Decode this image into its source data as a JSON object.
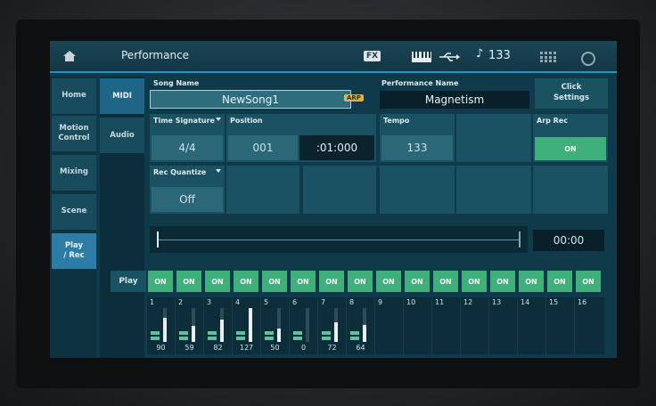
{
  "titlebar": {
    "title": "Performance",
    "fx_label": "FX",
    "tempo": "133",
    "icons": [
      "home-icon",
      "keyboard-icon",
      "usb-icon",
      "note-icon",
      "grid-icon",
      "gear-icon"
    ]
  },
  "nav": {
    "items": [
      "Home",
      "Motion\nControl",
      "Mixing",
      "Scene",
      "Play\n/ Rec"
    ],
    "active": "Play\n/ Rec"
  },
  "subnav": {
    "items": [
      "MIDI",
      "Audio"
    ],
    "active": "MIDI"
  },
  "song": {
    "label": "Song Name",
    "value": "NewSong1",
    "arp_badge": "ARP"
  },
  "performance": {
    "label": "Performance Name",
    "value": "Magnetism"
  },
  "click": {
    "label": "Click\nSettings"
  },
  "time_signature": {
    "label": "Time Signature",
    "value": "4/4"
  },
  "position": {
    "label": "Position",
    "measure": "001",
    "beat": ":01:000"
  },
  "tempo": {
    "label": "Tempo",
    "value": "133"
  },
  "arp_rec": {
    "label": "Arp Rec",
    "value": "ON"
  },
  "rec_quantize": {
    "label": "Rec Quantize",
    "value": "Off"
  },
  "time_display": "00:00",
  "play": {
    "label": "Play",
    "buttons": [
      "ON",
      "ON",
      "ON",
      "ON",
      "ON",
      "ON",
      "ON",
      "ON",
      "ON",
      "ON",
      "ON",
      "ON",
      "ON",
      "ON",
      "ON",
      "ON"
    ]
  },
  "tracks": [
    {
      "num": "1",
      "value": "90"
    },
    {
      "num": "2",
      "value": "59"
    },
    {
      "num": "3",
      "value": "82"
    },
    {
      "num": "4",
      "value": "127"
    },
    {
      "num": "5",
      "value": "50"
    },
    {
      "num": "6",
      "value": "0"
    },
    {
      "num": "7",
      "value": "72"
    },
    {
      "num": "8",
      "value": "64"
    },
    {
      "num": "9",
      "value": ""
    },
    {
      "num": "10",
      "value": ""
    },
    {
      "num": "11",
      "value": ""
    },
    {
      "num": "12",
      "value": ""
    },
    {
      "num": "13",
      "value": ""
    },
    {
      "num": "14",
      "value": ""
    },
    {
      "num": "15",
      "value": ""
    },
    {
      "num": "16",
      "value": ""
    }
  ],
  "colors": {
    "accent": "#2f8fb6",
    "on_button": "#3fb07b",
    "arp_badge": "#d8b35a"
  }
}
